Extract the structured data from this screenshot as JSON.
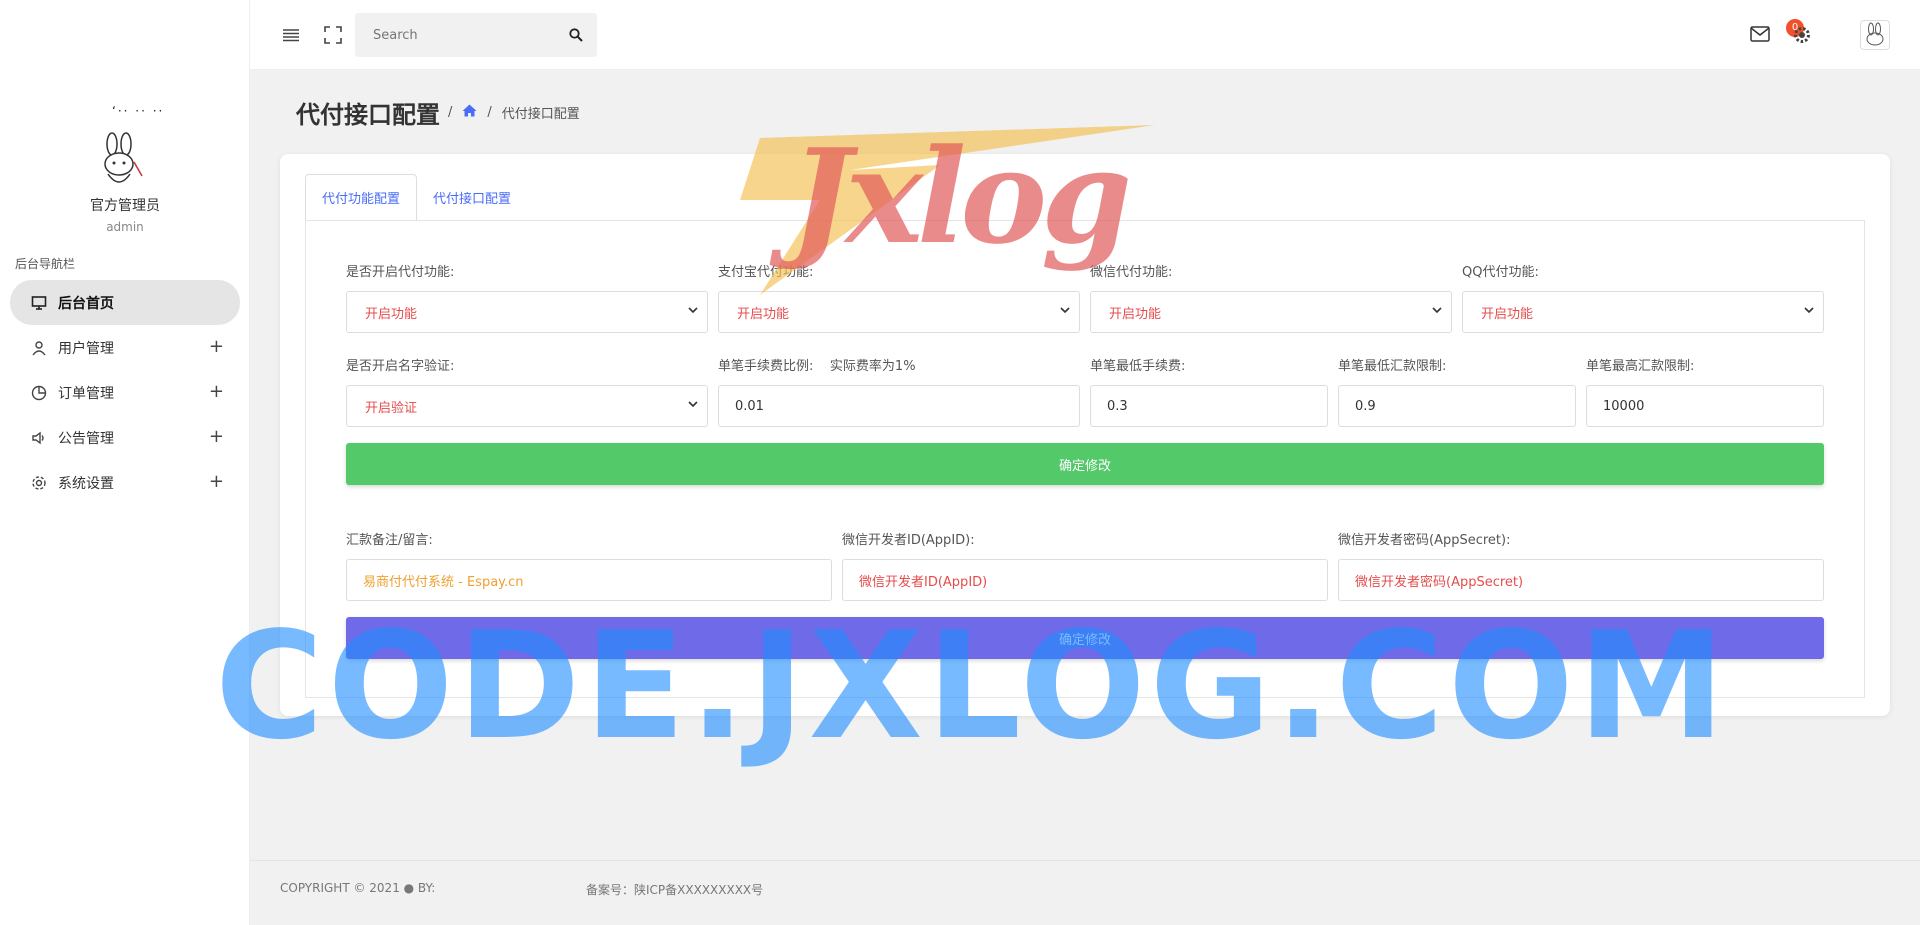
{
  "sidebar": {
    "logo_text": "ʻ·· ·· ··",
    "admin_name": "官方管理员",
    "admin_sub": "admin",
    "nav_title": "后台导航栏",
    "items": [
      {
        "label": "后台首页",
        "icon": "monitor-icon",
        "active": true
      },
      {
        "label": "用户管理",
        "icon": "user-icon"
      },
      {
        "label": "订单管理",
        "icon": "pie-chart-icon"
      },
      {
        "label": "公告管理",
        "icon": "speaker-icon"
      },
      {
        "label": "系统设置",
        "icon": "gear-icon"
      }
    ],
    "plus": "+"
  },
  "header": {
    "search_placeholder": "Search",
    "mail_badge": "0"
  },
  "page": {
    "title": "代付接口配置",
    "crumb_sep": "/",
    "crumb_current": "代付接口配置"
  },
  "tabs": [
    {
      "label": "代付功能配置",
      "active": true
    },
    {
      "label": "代付接口配置"
    }
  ],
  "form1": {
    "row1": [
      {
        "label": "是否开启代付功能:",
        "value": "开启功能"
      },
      {
        "label": "支付宝代付功能:",
        "value": "开启功能"
      },
      {
        "label": "微信代付功能:",
        "value": "开启功能"
      },
      {
        "label": "QQ代付功能:",
        "value": "开启功能"
      }
    ],
    "row2_select": {
      "label": "是否开启名字验证:",
      "value": "开启验证"
    },
    "fee_ratio": {
      "label": "单笔手续费比例:",
      "hint": "实际费率为1%",
      "value": "0.01"
    },
    "min_fee": {
      "label": "单笔最低手续费:",
      "value": "0.3"
    },
    "min_amount": {
      "label": "单笔最低汇款限制:",
      "value": "0.9"
    },
    "max_amount": {
      "label": "单笔最高汇款限制:",
      "value": "10000"
    },
    "submit": "确定修改"
  },
  "form2": {
    "remark": {
      "label": "汇款备注/留言:",
      "placeholder": "易商付代付系统 - Espay.cn"
    },
    "appid": {
      "label": "微信开发者ID(AppID):",
      "placeholder": "微信开发者ID(AppID)"
    },
    "secret": {
      "label": "微信开发者密码(AppSecret):",
      "placeholder": "微信开发者密码(AppSecret)"
    },
    "submit": "确定修改"
  },
  "footer": {
    "copyright": "COPYRIGHT © 2021  ● BY:",
    "icp": "备案号：陕ICP备XXXXXXXXX号"
  },
  "watermarks": {
    "script": "Jxlog",
    "domain": "CODE.JXLOG.COM"
  },
  "colors": {
    "accent": "#4a6cf7",
    "green_button": "#53c96a",
    "blue_button": "#6f6be8",
    "select_text": "#e64c4c",
    "badge": "#f0502b"
  }
}
